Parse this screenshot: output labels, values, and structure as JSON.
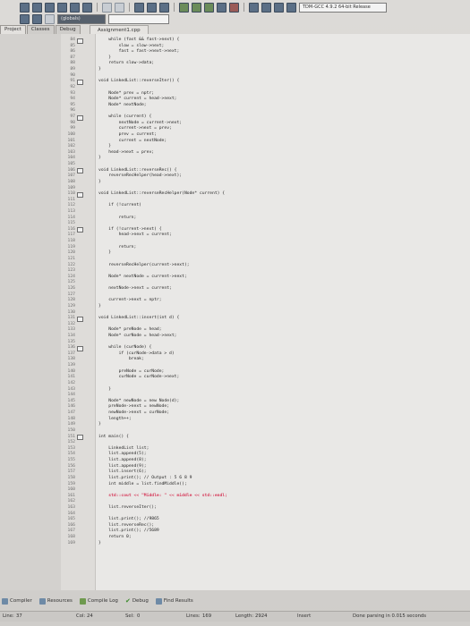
{
  "toolbar": {
    "build_target_select": "TDM-GCC 4.9.2 64-bit Release",
    "blank_select_1": "",
    "globals_select": "(globals)"
  },
  "left_tabs": [
    "Project",
    "Classes",
    "Debug"
  ],
  "file_tab": "Assignment1.cpp",
  "code_lines": [
    {
      "n": "84",
      "t": "    while (fast && fast->next) {",
      "fold": true
    },
    {
      "n": "85",
      "t": "        slow = slow->next;"
    },
    {
      "n": "86",
      "t": "        fast = fast->next->next;"
    },
    {
      "n": "87",
      "t": "    }"
    },
    {
      "n": "88",
      "t": "    return slow->data;"
    },
    {
      "n": "89",
      "t": "}"
    },
    {
      "n": "90",
      "t": ""
    },
    {
      "n": "91",
      "t": "void LinkedList::reverseIter() {",
      "fold": true
    },
    {
      "n": "92",
      "t": ""
    },
    {
      "n": "93",
      "t": "    Node* prev = nptr;"
    },
    {
      "n": "94",
      "t": "    Node* current = head->next;"
    },
    {
      "n": "95",
      "t": "    Node* nextNode;"
    },
    {
      "n": "96",
      "t": ""
    },
    {
      "n": "97",
      "t": "    while (current) {",
      "fold": true
    },
    {
      "n": "98",
      "t": "        nextNode = current->next;"
    },
    {
      "n": "99",
      "t": "        current->next = prev;"
    },
    {
      "n": "100",
      "t": "        prev = current;"
    },
    {
      "n": "101",
      "t": "        current = nextNode;"
    },
    {
      "n": "102",
      "t": "    }"
    },
    {
      "n": "103",
      "t": "    head->next = prev;"
    },
    {
      "n": "104",
      "t": "}"
    },
    {
      "n": "105",
      "t": ""
    },
    {
      "n": "106",
      "t": "void LinkedList::reverseRec() {",
      "fold": true
    },
    {
      "n": "107",
      "t": "    reverseRecHelper(head->next);"
    },
    {
      "n": "108",
      "t": "}"
    },
    {
      "n": "109",
      "t": ""
    },
    {
      "n": "110",
      "t": "void LinkedList::reverseRecHelper(Node* current) {",
      "fold": true
    },
    {
      "n": "111",
      "t": ""
    },
    {
      "n": "112",
      "t": "    if (!current)"
    },
    {
      "n": "113",
      "t": ""
    },
    {
      "n": "114",
      "t": "        return;"
    },
    {
      "n": "115",
      "t": ""
    },
    {
      "n": "116",
      "t": "    if (!current->next) {",
      "fold": true
    },
    {
      "n": "117",
      "t": "        head->next = current;"
    },
    {
      "n": "118",
      "t": ""
    },
    {
      "n": "119",
      "t": "        return;"
    },
    {
      "n": "120",
      "t": "    }"
    },
    {
      "n": "121",
      "t": ""
    },
    {
      "n": "122",
      "t": "    reverseRecHelper(current->next);"
    },
    {
      "n": "123",
      "t": ""
    },
    {
      "n": "124",
      "t": "    Node* nextNode = current->next;"
    },
    {
      "n": "125",
      "t": ""
    },
    {
      "n": "126",
      "t": "    nextNode->next = current;"
    },
    {
      "n": "127",
      "t": ""
    },
    {
      "n": "128",
      "t": "    current->next = nptr;"
    },
    {
      "n": "129",
      "t": "}"
    },
    {
      "n": "130",
      "t": ""
    },
    {
      "n": "131",
      "t": "void LinkedList::insert(int d) {",
      "fold": true
    },
    {
      "n": "132",
      "t": ""
    },
    {
      "n": "133",
      "t": "    Node* preNode = head;"
    },
    {
      "n": "134",
      "t": "    Node* curNode = head->next;"
    },
    {
      "n": "135",
      "t": ""
    },
    {
      "n": "136",
      "t": "    while (curNode) {",
      "fold": true
    },
    {
      "n": "137",
      "t": "        if (curNode->data > d)"
    },
    {
      "n": "138",
      "t": "            break;"
    },
    {
      "n": "139",
      "t": ""
    },
    {
      "n": "140",
      "t": "        preNode = curNode;"
    },
    {
      "n": "141",
      "t": "        curNode = curNode->next;"
    },
    {
      "n": "142",
      "t": ""
    },
    {
      "n": "143",
      "t": "    }"
    },
    {
      "n": "144",
      "t": ""
    },
    {
      "n": "145",
      "t": "    Node* newNode = new Node(d);"
    },
    {
      "n": "146",
      "t": "    preNode->next = newNode;"
    },
    {
      "n": "147",
      "t": "    newNode->next = curNode;"
    },
    {
      "n": "148",
      "t": "    length++;"
    },
    {
      "n": "149",
      "t": "}"
    },
    {
      "n": "150",
      "t": ""
    },
    {
      "n": "151",
      "t": "int main() {",
      "fold": true
    },
    {
      "n": "152",
      "t": ""
    },
    {
      "n": "153",
      "t": "    LinkedList list;"
    },
    {
      "n": "154",
      "t": "    list.append(5);"
    },
    {
      "n": "155",
      "t": "    list.append(8);"
    },
    {
      "n": "156",
      "t": "    list.append(9);"
    },
    {
      "n": "157",
      "t": "    list.insert(6);"
    },
    {
      "n": "158",
      "t": "    list.print(); // Output : 5 6 8 9"
    },
    {
      "n": "159",
      "t": "    int middle = list.findMiddle();"
    },
    {
      "n": "160",
      "t": ""
    },
    {
      "n": "161",
      "t": "    std::cout << \"Middle: \" << middle << std::endl;",
      "hl": true
    },
    {
      "n": "162",
      "t": ""
    },
    {
      "n": "163",
      "t": "    list.reverseIter();"
    },
    {
      "n": "164",
      "t": ""
    },
    {
      "n": "165",
      "t": "    list.print(); //9865"
    },
    {
      "n": "166",
      "t": "    list.reverseRec();"
    },
    {
      "n": "167",
      "t": "    list.print(); //5689"
    },
    {
      "n": "168",
      "t": "    return 0;"
    },
    {
      "n": "169",
      "t": "}"
    }
  ],
  "bottom_tabs": [
    {
      "label": "Compiler",
      "icon": "compiler-icon"
    },
    {
      "label": "Resources",
      "icon": "resources-icon"
    },
    {
      "label": "Compile Log",
      "icon": "compile-log-icon"
    },
    {
      "label": "Debug",
      "icon": "debug-check-icon"
    },
    {
      "label": "Find Results",
      "icon": "find-results-icon"
    }
  ],
  "status": {
    "line_label": "Line:",
    "line_value": "37",
    "col_label": "Col:",
    "col_value": "24",
    "sel_label": "Sel:",
    "sel_value": "0",
    "lines_label": "Lines:",
    "lines_value": "169",
    "length_label": "Length:",
    "length_value": "2924",
    "mode": "Insert",
    "message": "Done parsing in 0.015 seconds"
  },
  "colors": {
    "editor_bg": "#e9e8e6",
    "highlight_text": "#d63a5a"
  }
}
